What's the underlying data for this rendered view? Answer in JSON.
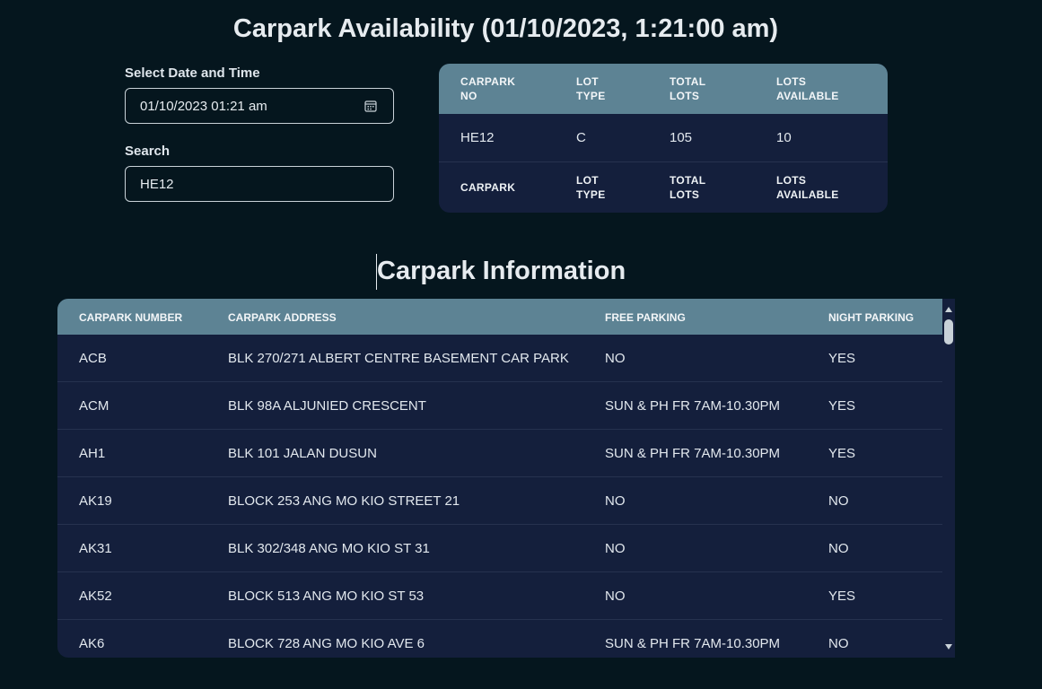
{
  "header": {
    "title": "Carpark Availability (01/10/2023, 1:21:00 am)"
  },
  "form": {
    "date_label": "Select Date and Time",
    "date_value": "01/10/2023 01:21 am",
    "search_label": "Search",
    "search_value": "HE12"
  },
  "availability": {
    "headers": [
      "CARPARK NO",
      "LOT TYPE",
      "TOTAL LOTS",
      "LOTS AVAILABLE"
    ],
    "head_lines": [
      [
        "CARPARK",
        "NO"
      ],
      [
        "LOT",
        "TYPE"
      ],
      [
        "TOTAL",
        "LOTS"
      ],
      [
        "LOTS",
        "AVAILABLE"
      ]
    ],
    "rows": [
      [
        "HE12",
        "C",
        "105",
        "10"
      ]
    ],
    "footer_lines": [
      [
        "CARPARK",
        ""
      ],
      [
        "LOT",
        "TYPE"
      ],
      [
        "TOTAL",
        "LOTS"
      ],
      [
        "LOTS",
        "AVAILABLE"
      ]
    ]
  },
  "info": {
    "title": "Carpark Information",
    "headers": [
      "CARPARK NUMBER",
      "CARPARK ADDRESS",
      "FREE PARKING",
      "NIGHT PARKING"
    ],
    "rows": [
      [
        "ACB",
        "BLK 270/271 ALBERT CENTRE BASEMENT CAR PARK",
        "NO",
        "YES"
      ],
      [
        "ACM",
        "BLK 98A ALJUNIED CRESCENT",
        "SUN & PH FR 7AM-10.30PM",
        "YES"
      ],
      [
        "AH1",
        "BLK 101 JALAN DUSUN",
        "SUN & PH FR 7AM-10.30PM",
        "YES"
      ],
      [
        "AK19",
        "BLOCK 253 ANG MO KIO STREET 21",
        "NO",
        "NO"
      ],
      [
        "AK31",
        "BLK 302/348 ANG MO KIO ST 31",
        "NO",
        "NO"
      ],
      [
        "AK52",
        "BLOCK 513 ANG MO KIO ST 53",
        "NO",
        "YES"
      ],
      [
        "AK6",
        "BLOCK 728 ANG MO KIO AVE 6",
        "SUN & PH FR 7AM-10.30PM",
        "NO"
      ]
    ]
  }
}
